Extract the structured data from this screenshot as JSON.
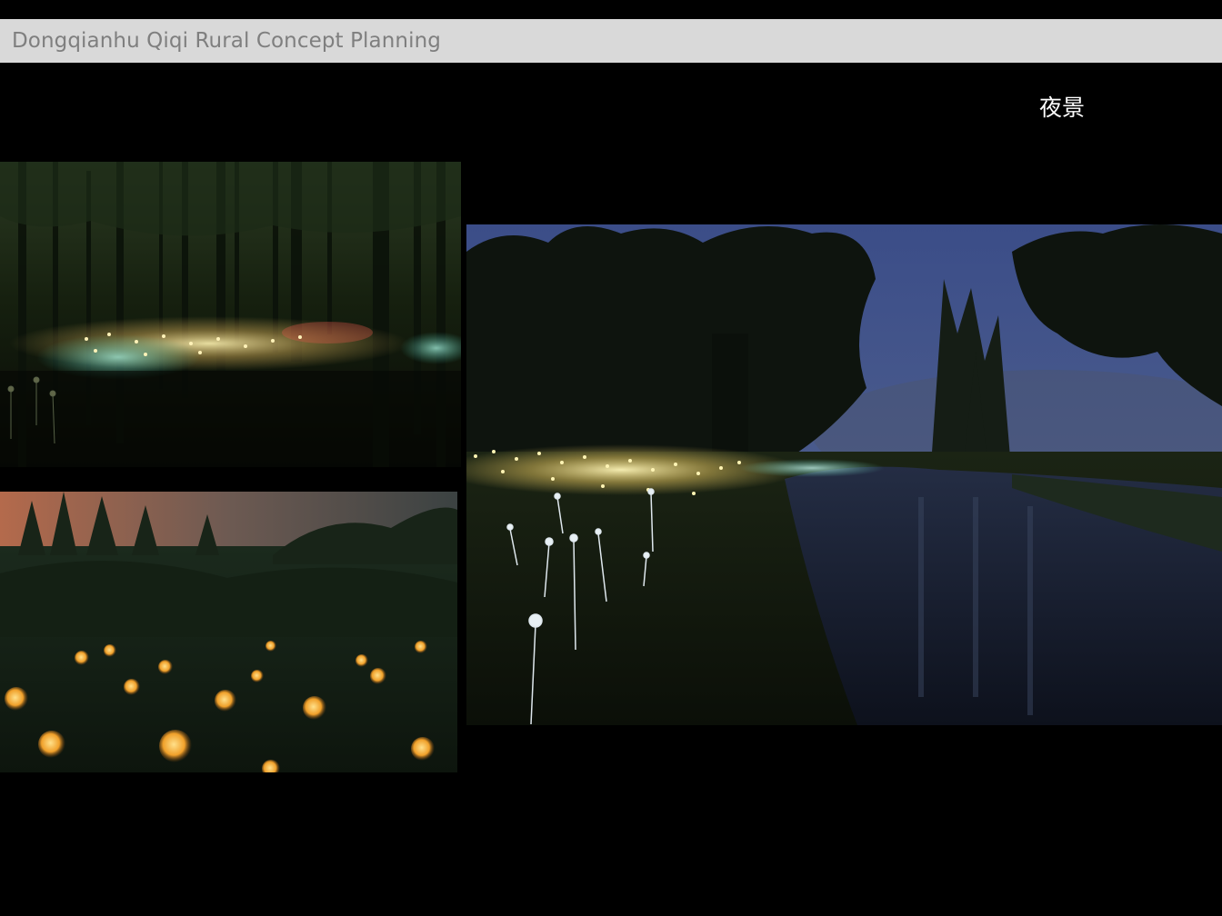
{
  "header": {
    "title": "Dongqianhu Qiqi Rural Concept Planning",
    "background_color": "#d9d9d9",
    "text_color": "#7f7f7f"
  },
  "section": {
    "label": "夜景"
  },
  "photos": [
    {
      "name": "forest-light-field-photo",
      "subject": "dark forest with a field of multicolored ground lights"
    },
    {
      "name": "meadow-glowing-orbs-photo",
      "subject": "meadow at dusk with glowing amber orb lights"
    },
    {
      "name": "riverside-light-field-photo",
      "subject": "riverbank at blue hour with a field of fiber-optic stem lights beside a pond"
    }
  ],
  "colors": {
    "background": "#000000",
    "label_text": "#ffffff"
  }
}
